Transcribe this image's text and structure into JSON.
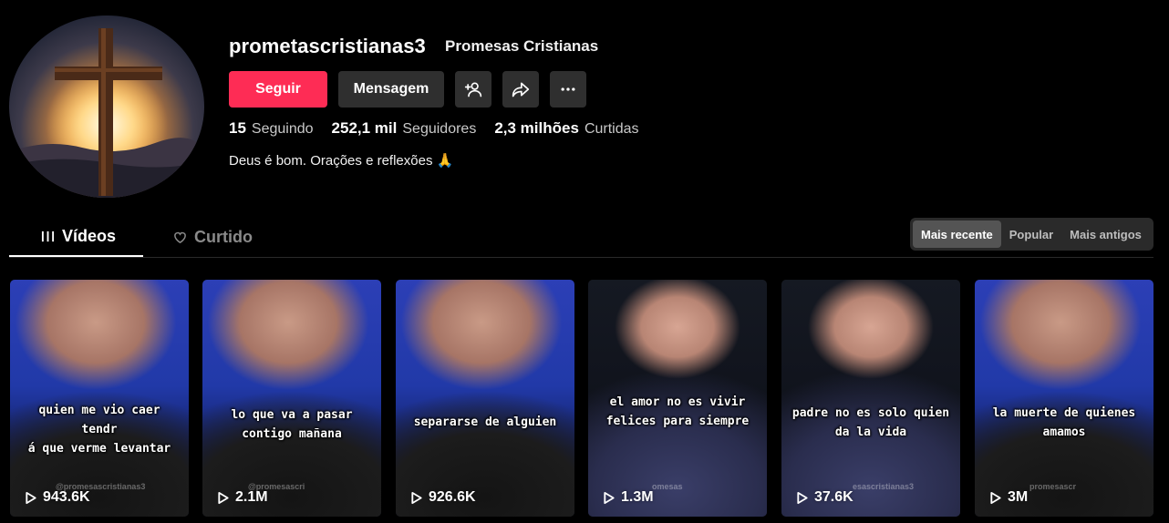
{
  "profile": {
    "username": "prometascristianas3",
    "display_name": "Promesas Cristianas",
    "bio": "Deus é bom. Orações e reflexões 🙏",
    "avatar_icon": "cross-sunset-avatar"
  },
  "actions": {
    "follow_label": "Seguir",
    "message_label": "Mensagem",
    "add_friend_icon": "add-user-icon",
    "share_icon": "share-icon",
    "more_icon": "more-icon"
  },
  "stats": {
    "following_count": "15",
    "following_label": "Seguindo",
    "followers_count": "252,1 mil",
    "followers_label": "Seguidores",
    "likes_count": "2,3 milhões",
    "likes_label": "Curtidas"
  },
  "tabs": {
    "videos_label": "Vídeos",
    "liked_label": "Curtido"
  },
  "sort": {
    "options": [
      "Mais recente",
      "Popular",
      "Mais antigos"
    ],
    "selected": "Mais recente"
  },
  "videos": [
    {
      "caption": "quien me vio caer tendr\ná que verme levantar",
      "views": "943.6K",
      "watermark": "@promesascristianas3"
    },
    {
      "caption": "lo que va a pasar\ncontigo mañana",
      "views": "2.1M",
      "watermark": "@promesascri"
    },
    {
      "caption": "separarse de alguien",
      "views": "926.6K",
      "watermark": ""
    },
    {
      "caption": "el amor no es vivir\nfelices para siempre",
      "views": "1.3M",
      "watermark": "omesas"
    },
    {
      "caption": "padre no es solo quien\nda la vida",
      "views": "37.6K",
      "watermark": "esascristianas3"
    },
    {
      "caption": "la muerte de quienes\namamos",
      "views": "3M",
      "watermark": "promesascr"
    }
  ],
  "colors": {
    "accent": "#fe2c55",
    "button_dark": "#2f2f2f",
    "background": "#000000"
  }
}
